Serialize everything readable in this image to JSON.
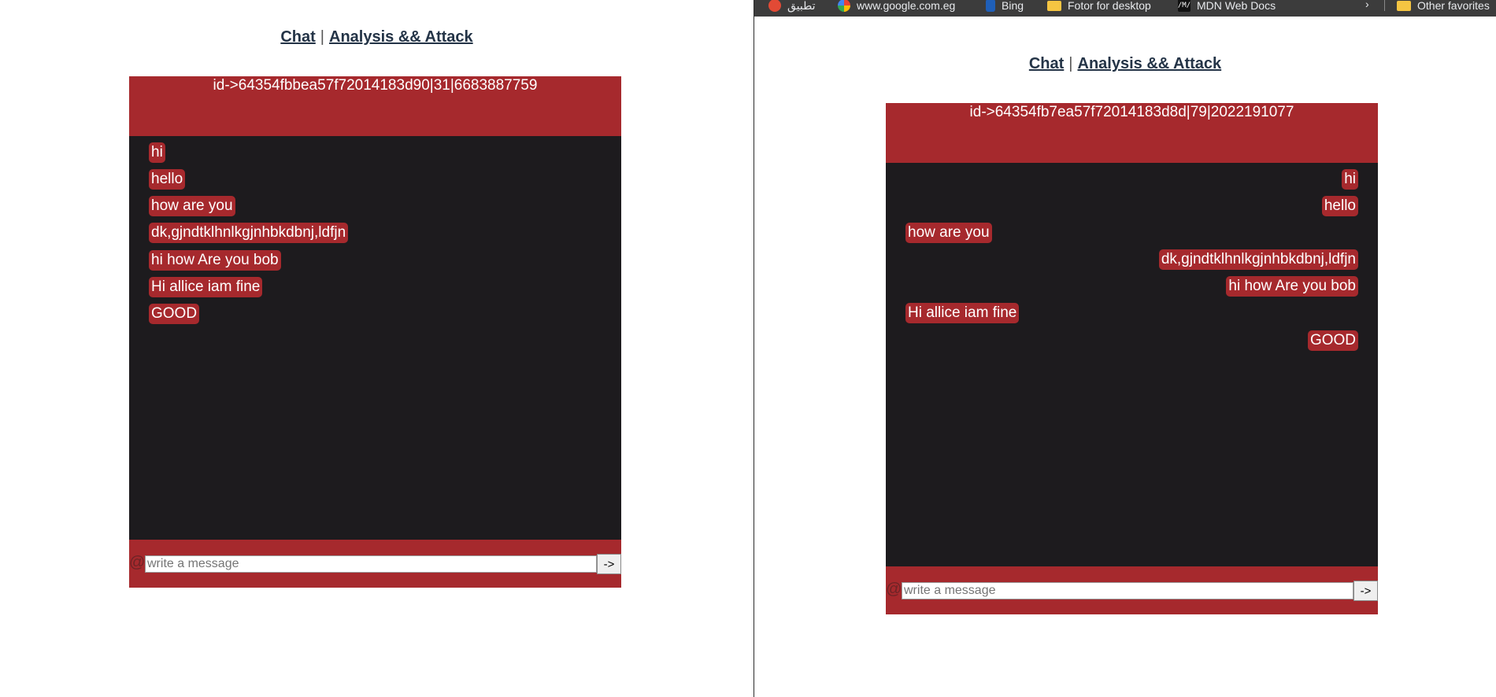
{
  "colors": {
    "accent_red": "#a6292d",
    "chat_bg": "#1d1b1e",
    "nav_text": "#243447"
  },
  "left_window": {
    "nav": {
      "chat_link": "Chat",
      "separator": "|",
      "analysis_link": "Analysis && Attack"
    },
    "chat": {
      "header_id": "id->64354fbbea57f72014183d90|31|6683887759",
      "messages": [
        {
          "text": "hi",
          "side": "left"
        },
        {
          "text": "hello",
          "side": "left"
        },
        {
          "text": "how are you",
          "side": "right"
        },
        {
          "text": "dk,gjndtklhnlkgjnhbkdbnj,ldfjn",
          "side": "left"
        },
        {
          "text": "hi how Are you bob",
          "side": "left"
        },
        {
          "text": "Hi allice iam fine",
          "side": "right"
        },
        {
          "text": "GOOD",
          "side": "left"
        }
      ],
      "input_placeholder": "write a message",
      "send_label": "->",
      "at_icon": "@"
    }
  },
  "right_window": {
    "bookmarks": [
      {
        "label": "تطبيق",
        "icon": "app-icon"
      },
      {
        "label": "www.google.com.eg",
        "icon": "google-icon"
      },
      {
        "label": "Bing",
        "icon": "bing-icon"
      },
      {
        "label": "Fotor for desktop",
        "icon": "folder-icon"
      },
      {
        "label": "MDN Web Docs",
        "icon": "mdn-icon"
      },
      {
        "label": "Other favorites",
        "icon": "folder-icon"
      }
    ],
    "nav": {
      "chat_link": "Chat",
      "separator": "|",
      "analysis_link": "Analysis && Attack"
    },
    "chat": {
      "header_id": "id->64354fb7ea57f72014183d8d|79|2022191077",
      "messages": [
        {
          "text": "hi",
          "side": "right"
        },
        {
          "text": "hello",
          "side": "right"
        },
        {
          "text": "how are you",
          "side": "left"
        },
        {
          "text": "dk,gjndtklhnlkgjnhbkdbnj,ldfjn",
          "side": "right"
        },
        {
          "text": "hi how Are you bob",
          "side": "right"
        },
        {
          "text": "Hi allice iam fine",
          "side": "left"
        },
        {
          "text": "GOOD",
          "side": "right"
        }
      ],
      "input_placeholder": "write a message",
      "send_label": "->",
      "at_icon": "@"
    }
  }
}
